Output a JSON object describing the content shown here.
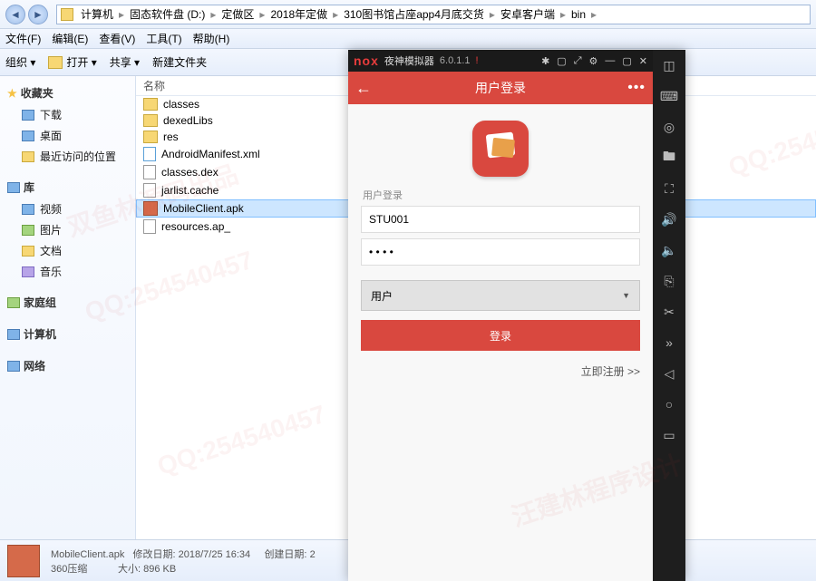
{
  "breadcrumbs": [
    "计算机",
    "固态软件盘 (D:)",
    "定做区",
    "2018年定做",
    "310图书馆占座app4月底交货",
    "安卓客户端",
    "bin"
  ],
  "menu": {
    "file": "文件(F)",
    "edit": "编辑(E)",
    "view": "查看(V)",
    "tool": "工具(T)",
    "help": "帮助(H)"
  },
  "toolbar": {
    "org": "组织 ▾",
    "open": "打开 ▾",
    "share": "共享 ▾",
    "newfolder": "新建文件夹"
  },
  "columns": {
    "name": "名称"
  },
  "sidebar": {
    "fav": {
      "head": "收藏夹",
      "items": [
        "下载",
        "桌面",
        "最近访问的位置"
      ]
    },
    "lib": {
      "head": "库",
      "items": [
        "视频",
        "图片",
        "文档",
        "音乐"
      ]
    },
    "home": {
      "head": "家庭组"
    },
    "pc": {
      "head": "计算机"
    },
    "net": {
      "head": "网络"
    }
  },
  "files": [
    {
      "name": "classes",
      "type": "folder"
    },
    {
      "name": "dexedLibs",
      "type": "folder"
    },
    {
      "name": "res",
      "type": "folder"
    },
    {
      "name": "AndroidManifest.xml",
      "type": "xml"
    },
    {
      "name": "classes.dex",
      "type": "file"
    },
    {
      "name": "jarlist.cache",
      "type": "file"
    },
    {
      "name": "MobileClient.apk",
      "type": "apk",
      "selected": true
    },
    {
      "name": "resources.ap_",
      "type": "file"
    }
  ],
  "status": {
    "name": "MobileClient.apk",
    "type": "360压缩",
    "mod_label": "修改日期:",
    "mod_value": "2018/7/25 16:34",
    "create_label": "创建日期:",
    "create_value": "2",
    "size_label": "大小:",
    "size_value": "896 KB"
  },
  "emu": {
    "brand": "nox",
    "title": "夜神模拟器",
    "version": "6.0.1.1",
    "app": {
      "header": "用户登录",
      "section_label": "用户登录",
      "username": "STU001",
      "password": "• • • •",
      "role": "用户",
      "login_btn": "登录",
      "register": "立即注册 >>"
    }
  },
  "watermarks": [
    "双鱼林源码出品",
    "QQ:254540457",
    "汪建林程序设计"
  ]
}
